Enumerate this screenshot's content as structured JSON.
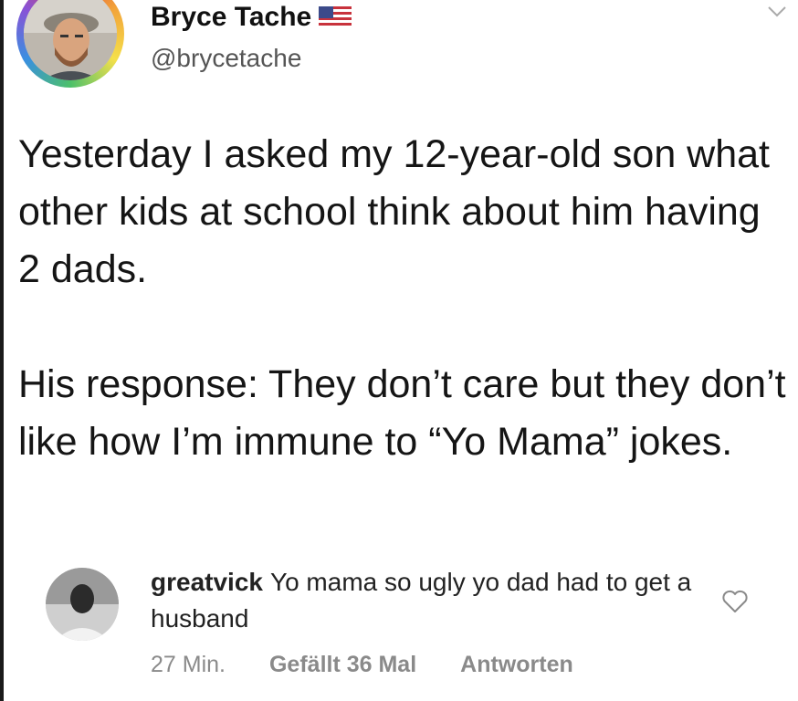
{
  "tweet": {
    "author_name": "Bryce Tache",
    "handle": "@brycetache",
    "flag_icon": "us-flag-icon",
    "menu_icon": "chevron-down-icon",
    "paragraph1": "Yesterday I asked my 12-year-old son what other kids at school think about him having 2 dads.",
    "paragraph2": "His response: They don’t care but they don’t like how I’m immune to “Yo Mama” jokes."
  },
  "comment": {
    "username": "greatvick",
    "text": "Yo mama so ugly yo dad had to get a husband",
    "time": "27 Min.",
    "likes": "Gefällt 36 Mal",
    "reply_label": "Antworten",
    "like_icon": "heart-icon"
  },
  "colors": {
    "text": "#111111",
    "handle": "#555555",
    "meta": "#8a8a8a",
    "background": "#ffffff"
  }
}
